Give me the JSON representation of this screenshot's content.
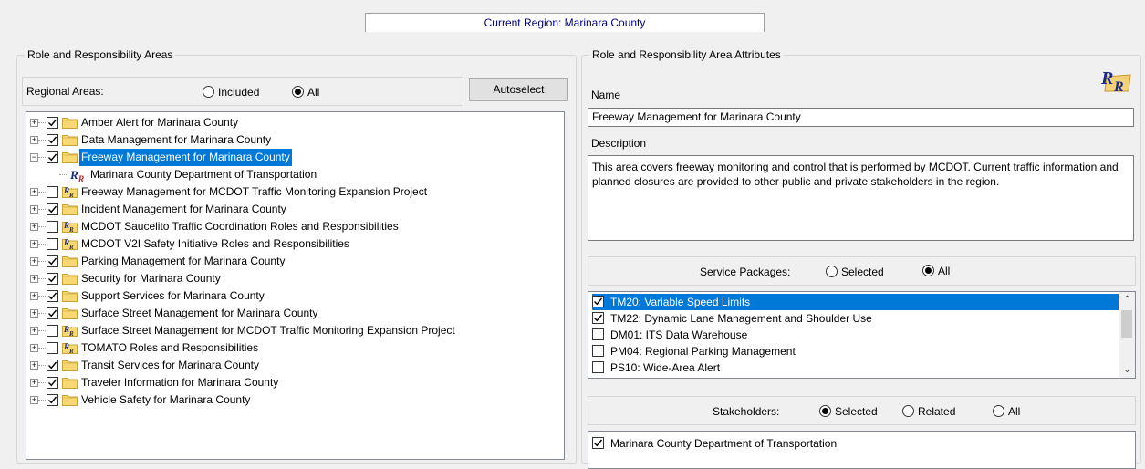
{
  "region": {
    "label": "Current Region: Marinara County"
  },
  "left": {
    "title": "Role and Responsibility Areas",
    "regional_label": "Regional Areas:",
    "opt_included": "Included",
    "opt_all": "All",
    "autoselect": "Autoselect",
    "tree": [
      {
        "label": "Amber Alert for Marinara County",
        "checked": true,
        "expanded": false,
        "selected": false
      },
      {
        "label": "Data Management for Marinara County",
        "checked": true,
        "expanded": false,
        "selected": false
      },
      {
        "label": "Freeway Management for Marinara County",
        "checked": true,
        "expanded": true,
        "selected": true
      },
      {
        "label": "Marinara County Department of Transportation",
        "child": true
      },
      {
        "label": "Freeway Management for MCDOT Traffic Monitoring Expansion Project",
        "checked": false,
        "expanded": false,
        "selected": false
      },
      {
        "label": "Incident Management for Marinara County",
        "checked": true,
        "expanded": false,
        "selected": false
      },
      {
        "label": "MCDOT Saucelito Traffic Coordination Roles and Responsibilities",
        "checked": false,
        "expanded": false,
        "selected": false
      },
      {
        "label": "MCDOT V2I Safety Initiative Roles and Responsibilities",
        "checked": false,
        "expanded": false,
        "selected": false
      },
      {
        "label": "Parking Management for Marinara County",
        "checked": true,
        "expanded": false,
        "selected": false
      },
      {
        "label": "Security for Marinara County",
        "checked": true,
        "expanded": false,
        "selected": false
      },
      {
        "label": "Support Services for Marinara County",
        "checked": true,
        "expanded": false,
        "selected": false
      },
      {
        "label": "Surface Street Management for Marinara County",
        "checked": true,
        "expanded": false,
        "selected": false
      },
      {
        "label": "Surface Street Management for MCDOT Traffic Monitoring Expansion Project",
        "checked": false,
        "expanded": false,
        "selected": false
      },
      {
        "label": "TOMATO Roles and Responsibilities",
        "checked": false,
        "expanded": false,
        "selected": false
      },
      {
        "label": "Transit Services for Marinara County",
        "checked": true,
        "expanded": false,
        "selected": false
      },
      {
        "label": "Traveler Information for Marinara County",
        "checked": true,
        "expanded": false,
        "selected": false
      },
      {
        "label": "Vehicle Safety for Marinara County",
        "checked": true,
        "expanded": false,
        "selected": false
      }
    ]
  },
  "right": {
    "title": "Role and Responsibility Area Attributes",
    "name_label": "Name",
    "name_value": "Freeway Management for Marinara County",
    "desc_label": "Description",
    "desc_value": "This area covers freeway monitoring and control that is performed by MCDOT.  Current traffic information and planned closures are provided to other public and private stakeholders in the region.",
    "sp_label": "Service Packages:",
    "sp_opt_selected": "Selected",
    "sp_opt_all": "All",
    "service_packages": [
      {
        "label": "TM20: Variable Speed Limits",
        "checked": true,
        "selected": true
      },
      {
        "label": "TM22: Dynamic Lane Management and Shoulder Use",
        "checked": true,
        "selected": false
      },
      {
        "label": "DM01: ITS Data Warehouse",
        "checked": false,
        "selected": false
      },
      {
        "label": "PM04: Regional Parking Management",
        "checked": false,
        "selected": false
      },
      {
        "label": "PS10: Wide-Area Alert",
        "checked": false,
        "selected": false
      }
    ],
    "sh_label": "Stakeholders:",
    "sh_opt_selected": "Selected",
    "sh_opt_related": "Related",
    "sh_opt_all": "All",
    "stakeholders": [
      {
        "label": "Marinara County Department of Transportation",
        "checked": true
      }
    ]
  },
  "colors": {
    "selection": "#0078d7",
    "region_text": "#000080",
    "rr_icon": "#1a2a8a"
  },
  "icons": {
    "folder": "folder-icon",
    "rr": "rr-icon",
    "expand": "expand-icon",
    "collapse": "collapse-icon"
  }
}
